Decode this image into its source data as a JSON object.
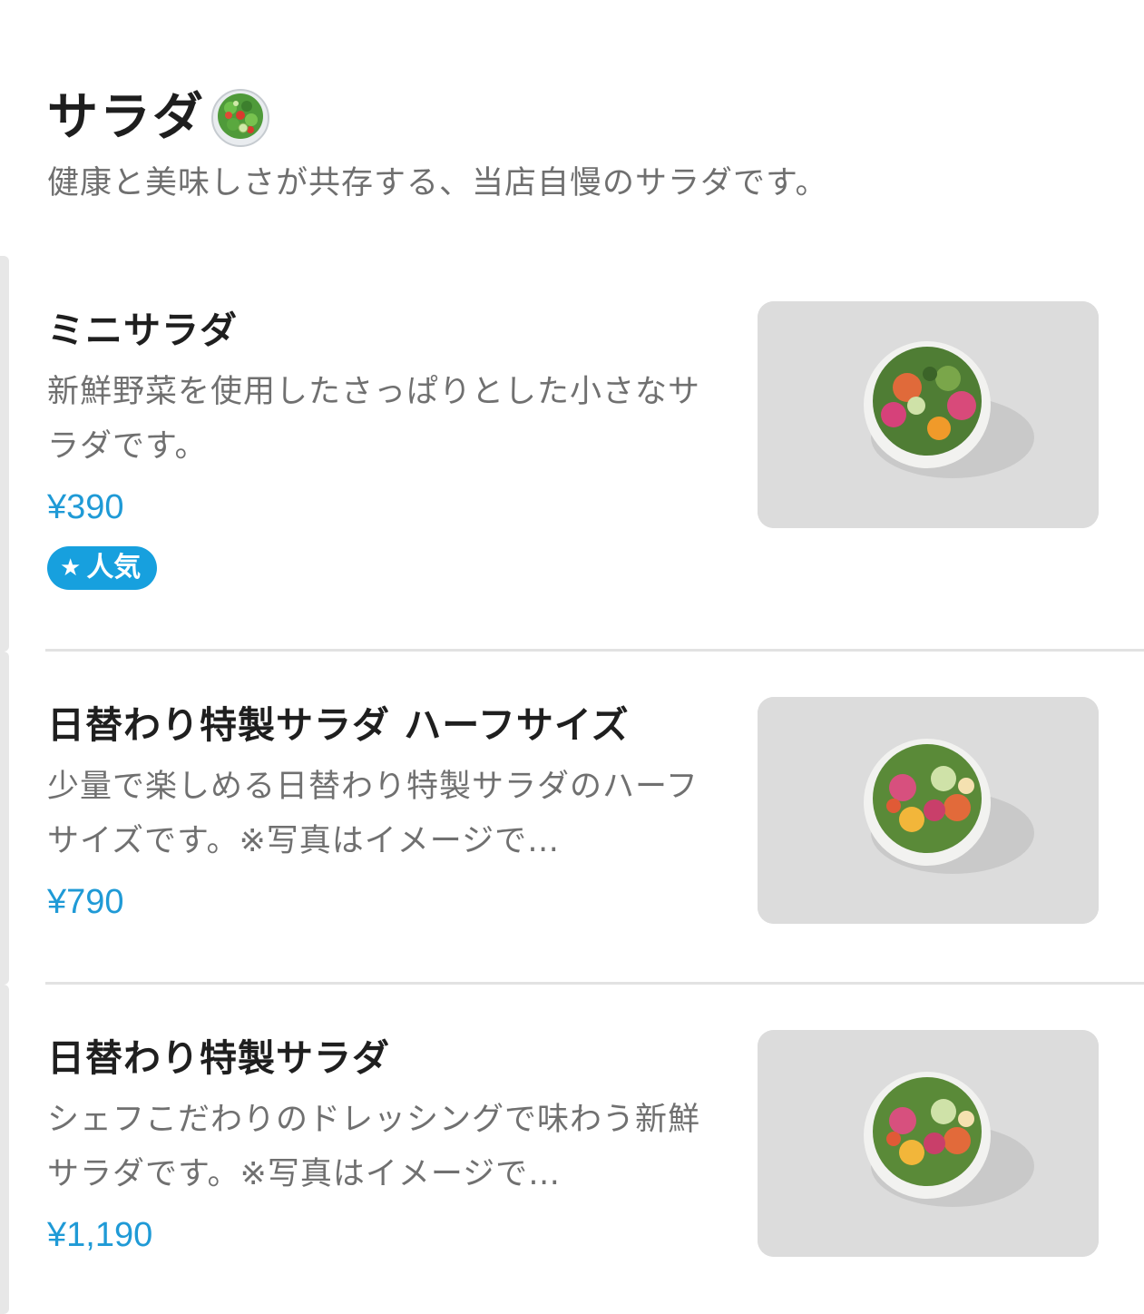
{
  "section": {
    "title": "サラダ",
    "emoji_icon": "green-salad-icon",
    "description": "健康と美味しさが共存する、当店自慢のサラダです。"
  },
  "items": [
    {
      "name": "ミニサラダ",
      "description": "新鮮野菜を使用したさっぱりとした小さなサラダです。",
      "price": "¥390",
      "badge": "人気",
      "badge_icon": "star-icon",
      "image_icon": "salad-bowl-photo"
    },
    {
      "name": "日替わり特製サラダ ハーフサイズ",
      "description": "少量で楽しめる日替わり特製サラダのハーフサイズです。※写真はイメージで…",
      "price": "¥790",
      "image_icon": "salad-bowl-photo"
    },
    {
      "name": "日替わり特製サラダ",
      "description": "シェフこだわりのドレッシングで味わう新鮮サラダです。※写真はイメージで…",
      "price": "¥1,190",
      "image_icon": "salad-bowl-photo"
    }
  ],
  "colors": {
    "price": "#1f9ad6",
    "badge_bg": "#17a0de",
    "image_bg": "#d9d9d9"
  }
}
